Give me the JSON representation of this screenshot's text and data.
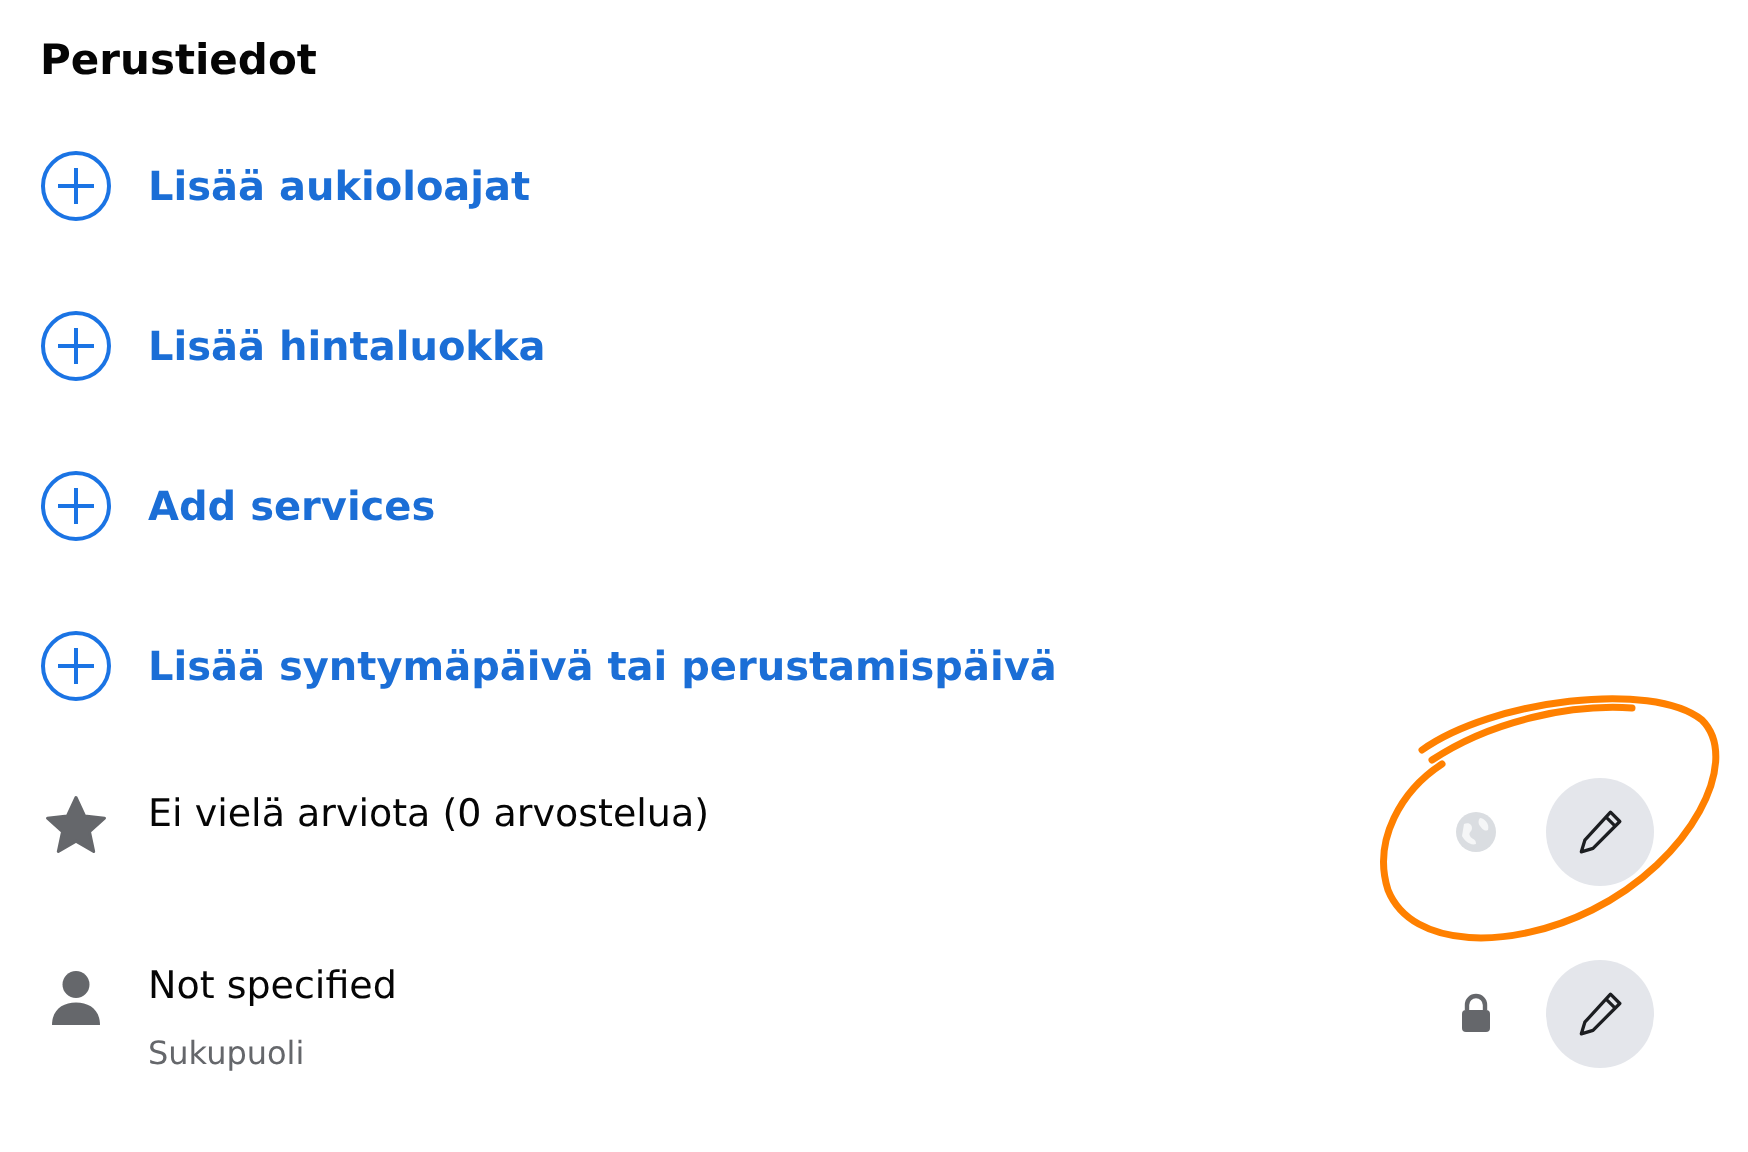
{
  "section_title": "Perustiedot",
  "items": [
    {
      "kind": "add",
      "label": "Lisää aukioloajat"
    },
    {
      "kind": "add",
      "label": "Lisää hintaluokka"
    },
    {
      "kind": "add",
      "label": "Add services"
    },
    {
      "kind": "add",
      "label": "Lisää syntymäpäivä tai perustamispäivä"
    },
    {
      "kind": "rating",
      "text": "Ei vielä arviota (0 arvostelua)",
      "highlighted": true
    },
    {
      "kind": "gender",
      "text": "Not specified",
      "subtitle": "Sukupuoli",
      "highlighted": false
    }
  ]
}
